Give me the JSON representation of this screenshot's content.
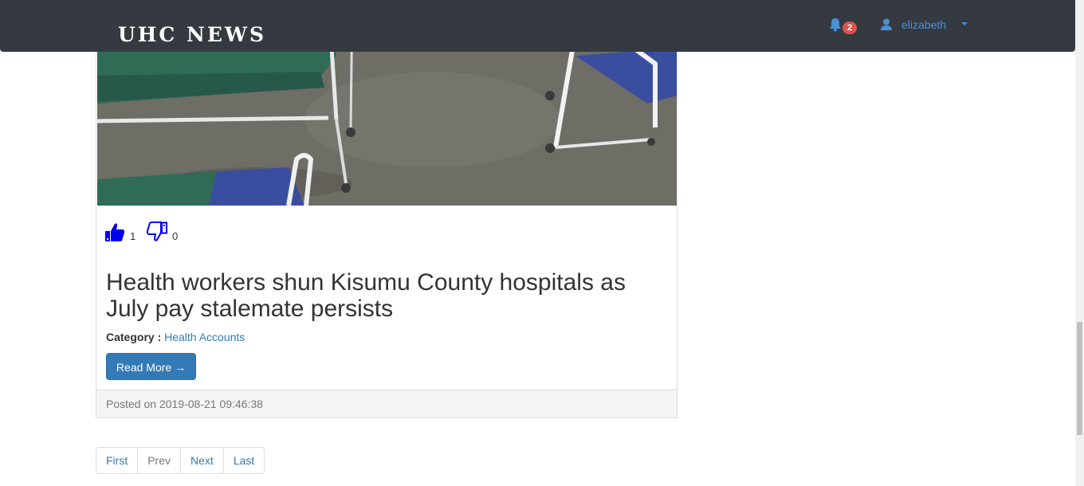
{
  "navbar": {
    "brand": "UHC NEWS",
    "notifications_count": "2",
    "user_name": "elizabeth"
  },
  "post": {
    "likes": "1",
    "dislikes": "0",
    "title": "Health workers shun Kisumu County hospitals as July pay stalemate persists",
    "category_label": "Category :",
    "category_value": "Health Accounts",
    "read_more_label": "Read More →",
    "posted_on": "Posted on 2019-08-21 09:46:38"
  },
  "pagination": {
    "first": "First",
    "prev": "Prev",
    "next": "Next",
    "last": "Last"
  },
  "colors": {
    "navbar_bg": "#343a40",
    "link": "#337ab7",
    "badge": "#d9534f",
    "vote_icon": "#0000ee"
  },
  "icons": {
    "like": "thumbs-up-icon",
    "dislike": "thumbs-down-icon",
    "notifications": "bell-icon",
    "user": "user-icon",
    "dropdown": "caret-down-icon"
  }
}
